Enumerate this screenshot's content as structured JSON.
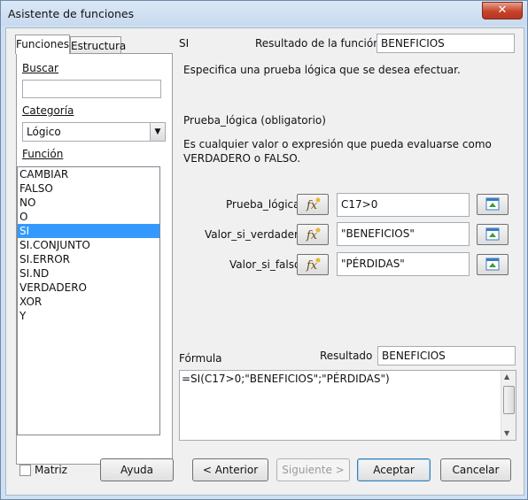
{
  "window": {
    "title": "Asistente de funciones",
    "close_label": "✕"
  },
  "tabs": [
    {
      "label": "Funciones",
      "active": true
    },
    {
      "label": "Estructura",
      "active": false
    }
  ],
  "left": {
    "search_label": "Buscar",
    "search_value": "",
    "category_label": "Categoría",
    "category_value": "Lógico",
    "function_label": "Función",
    "functions": [
      "CAMBIAR",
      "FALSO",
      "NO",
      "O",
      "SI",
      "SI.CONJUNTO",
      "SI.ERROR",
      "SI.ND",
      "VERDADERO",
      "XOR",
      "Y"
    ],
    "selected_function": "SI"
  },
  "right": {
    "function_name": "SI",
    "result_label": "Resultado de la función",
    "result_value": "BENEFICIOS",
    "description": "Especifica una prueba lógica que se desea efectuar.",
    "arg_title": "Prueba_lógica (obligatorio)",
    "arg_description_1": "Es cualquier valor o expresión que pueda evaluarse como",
    "arg_description_2": "VERDADERO o FALSO.",
    "args": [
      {
        "label": "Prueba_lógica",
        "value": "C17>0"
      },
      {
        "label": "Valor_si_verdadero",
        "value": "\"BENEFICIOS\""
      },
      {
        "label": "Valor_si_falso",
        "value": "\"PÉRDIDAS\""
      }
    ],
    "formula_label": "Fórmula",
    "resultado_label": "Resultado",
    "resultado_value": "BENEFICIOS",
    "formula_text": "=SI(C17>0;\"BENEFICIOS\";\"PÉRDIDAS\")"
  },
  "footer": {
    "matrix_label": "Matriz",
    "help": "Ayuda",
    "back": "< Anterior",
    "next": "Siguiente >",
    "ok": "Aceptar",
    "cancel": "Cancelar"
  },
  "colors": {
    "selection": "#3399ff",
    "titlebar": "#c8daef",
    "close": "#c7432b"
  }
}
